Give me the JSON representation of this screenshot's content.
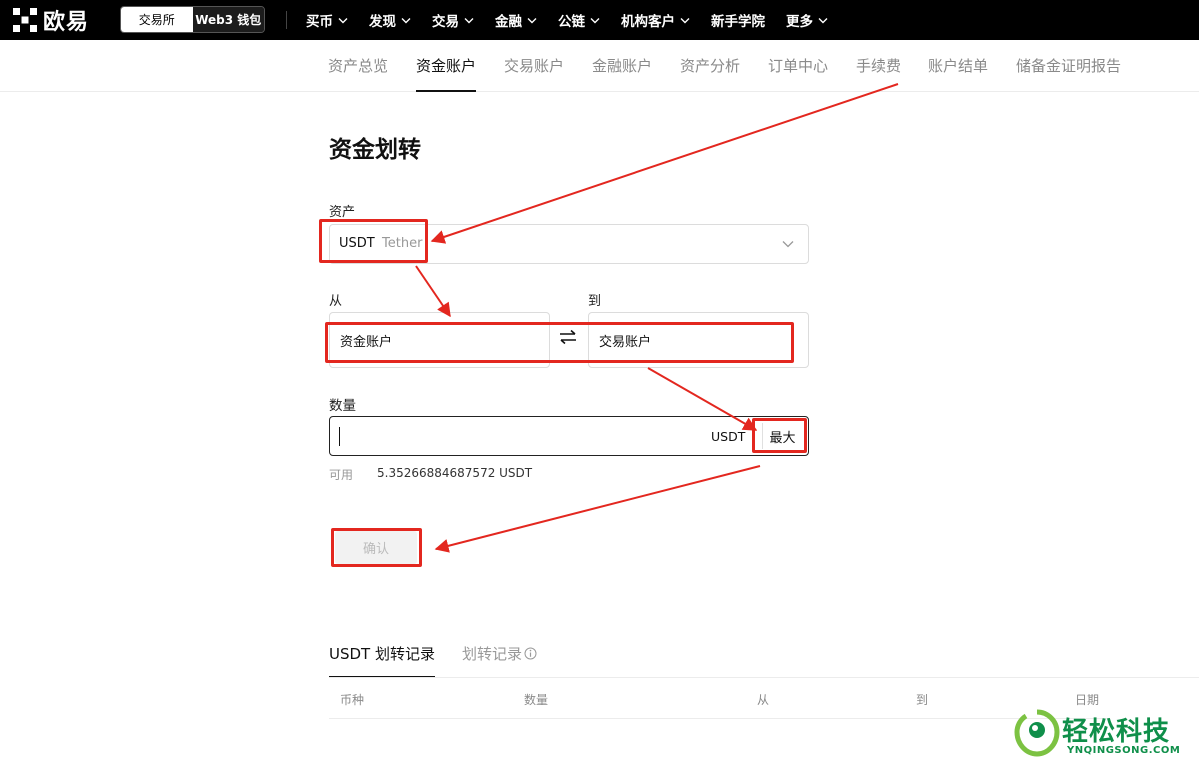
{
  "header": {
    "logo_text": "欧易",
    "switch": {
      "exchange": "交易所",
      "wallet": "Web3 钱包"
    },
    "nav": [
      {
        "label": "买币",
        "chevron": true
      },
      {
        "label": "发现",
        "chevron": true
      },
      {
        "label": "交易",
        "chevron": true
      },
      {
        "label": "金融",
        "chevron": true
      },
      {
        "label": "公链",
        "chevron": true
      },
      {
        "label": "机构客户",
        "chevron": true
      },
      {
        "label": "新手学院",
        "chevron": false
      },
      {
        "label": "更多",
        "chevron": true
      }
    ]
  },
  "subnav": {
    "tabs": [
      "资产总览",
      "资金账户",
      "交易账户",
      "金融账户",
      "资产分析",
      "订单中心",
      "手续费",
      "账户结单",
      "储备金证明报告"
    ],
    "active_index": 1
  },
  "form": {
    "title": "资金划转",
    "asset_label": "资产",
    "asset_code": "USDT",
    "asset_name": "Tether",
    "from_label": "从",
    "to_label": "到",
    "from_account": "资金账户",
    "to_account": "交易账户",
    "amount_label": "数量",
    "amount_value": "",
    "amount_unit": "USDT",
    "max_label": "最大",
    "available_label": "可用",
    "available_value": "5.35266884687572 USDT",
    "confirm_label": "确认"
  },
  "records": {
    "tab_active": "USDT 划转记录",
    "tab_inactive": "划转记录",
    "columns": [
      "币种",
      "数量",
      "从",
      "到",
      "日期"
    ]
  },
  "watermark": {
    "text": "轻松科技",
    "sub": "YNQINGSONG.COM"
  },
  "colors": {
    "annotation_red": "#e3271f",
    "watermark_green": "#0f8f4a",
    "topbar": "#000000"
  }
}
